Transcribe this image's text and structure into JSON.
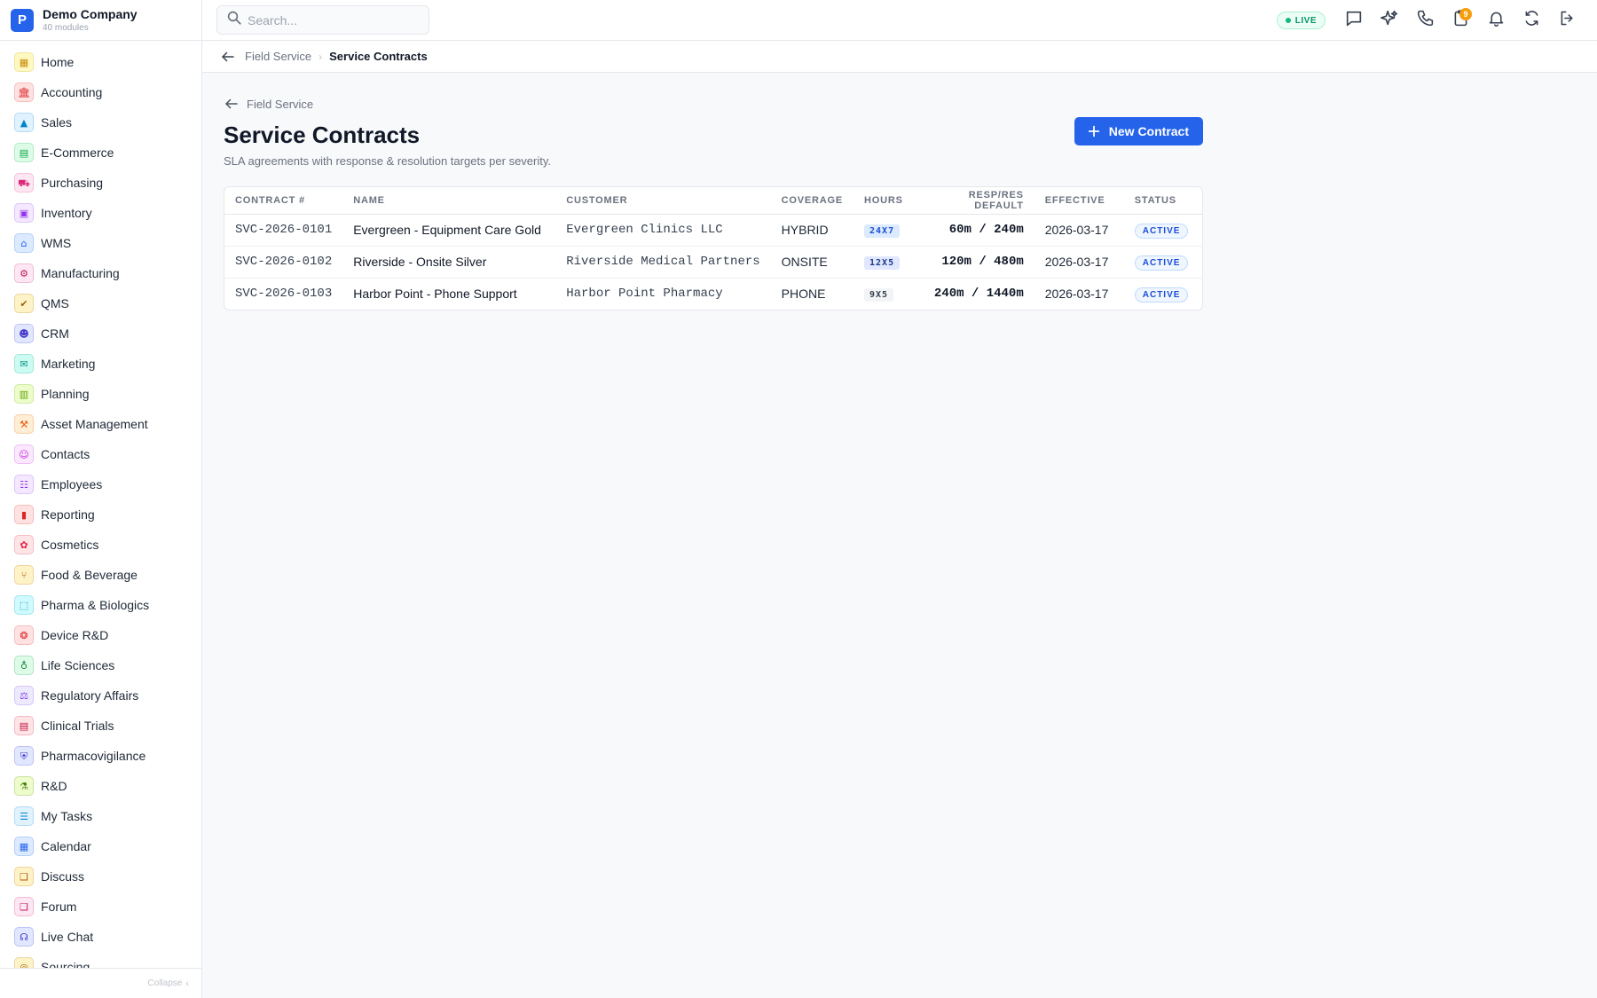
{
  "brand": {
    "logo_letter": "P",
    "name": "Demo Company",
    "subtitle": "40 modules"
  },
  "sidebar": {
    "items": [
      {
        "label": "Home",
        "icon": "grid-icon",
        "glyph": "▦",
        "color": "#ca8a04",
        "bg": "#fef9c3"
      },
      {
        "label": "Accounting",
        "icon": "bank-icon",
        "glyph": "🏛",
        "color": "#dc2626",
        "bg": "#fee2e2"
      },
      {
        "label": "Sales",
        "icon": "flask-icon",
        "glyph": "▲",
        "color": "#0284c7",
        "bg": "#e0f2fe"
      },
      {
        "label": "E-Commerce",
        "icon": "store-icon",
        "glyph": "▤",
        "color": "#16a34a",
        "bg": "#dcfce7"
      },
      {
        "label": "Purchasing",
        "icon": "cart-icon",
        "glyph": "⛟",
        "color": "#db2777",
        "bg": "#fce7f3"
      },
      {
        "label": "Inventory",
        "icon": "box-icon",
        "glyph": "▣",
        "color": "#9333ea",
        "bg": "#f3e8ff"
      },
      {
        "label": "WMS",
        "icon": "warehouse-icon",
        "glyph": "⌂",
        "color": "#2563eb",
        "bg": "#dbeafe"
      },
      {
        "label": "Manufacturing",
        "icon": "factory-icon",
        "glyph": "⚙",
        "color": "#be185d",
        "bg": "#fce7f3"
      },
      {
        "label": "QMS",
        "icon": "check-badge-icon",
        "glyph": "✔",
        "color": "#a16207",
        "bg": "#fef3c7"
      },
      {
        "label": "CRM",
        "icon": "users-icon",
        "glyph": "☻",
        "color": "#4338ca",
        "bg": "#e0e7ff"
      },
      {
        "label": "Marketing",
        "icon": "megaphone-icon",
        "glyph": "✉",
        "color": "#0d9488",
        "bg": "#ccfbf1"
      },
      {
        "label": "Planning",
        "icon": "clipboard-icon",
        "glyph": "▥",
        "color": "#65a30d",
        "bg": "#ecfccb"
      },
      {
        "label": "Asset Management",
        "icon": "tools-icon",
        "glyph": "⚒",
        "color": "#ea580c",
        "bg": "#ffedd5"
      },
      {
        "label": "Contacts",
        "icon": "contact-card-icon",
        "glyph": "☺",
        "color": "#c026d3",
        "bg": "#fae8ff"
      },
      {
        "label": "Employees",
        "icon": "id-badge-icon",
        "glyph": "☷",
        "color": "#9333ea",
        "bg": "#f3e8ff"
      },
      {
        "label": "Reporting",
        "icon": "bar-chart-icon",
        "glyph": "▮",
        "color": "#dc2626",
        "bg": "#fee2e2"
      },
      {
        "label": "Cosmetics",
        "icon": "flower-icon",
        "glyph": "✿",
        "color": "#e11d48",
        "bg": "#ffe4e6"
      },
      {
        "label": "Food & Beverage",
        "icon": "utensils-icon",
        "glyph": "⑂",
        "color": "#b45309",
        "bg": "#fef3c7"
      },
      {
        "label": "Pharma & Biologics",
        "icon": "pill-bottle-icon",
        "glyph": "⬚",
        "color": "#0891b2",
        "bg": "#cffafe"
      },
      {
        "label": "Device R&D",
        "icon": "chip-icon",
        "glyph": "❂",
        "color": "#dc2626",
        "bg": "#fee2e2"
      },
      {
        "label": "Life Sciences",
        "icon": "microscope-icon",
        "glyph": "♁",
        "color": "#15803d",
        "bg": "#dcfce7"
      },
      {
        "label": "Regulatory Affairs",
        "icon": "gavel-icon",
        "glyph": "⚖",
        "color": "#7c3aed",
        "bg": "#ede9fe"
      },
      {
        "label": "Clinical Trials",
        "icon": "clipboard-list-icon",
        "glyph": "▤",
        "color": "#be123c",
        "bg": "#ffe4e6"
      },
      {
        "label": "Pharmacovigilance",
        "icon": "shield-icon",
        "glyph": "⛨",
        "color": "#4338ca",
        "bg": "#e0e7ff"
      },
      {
        "label": "R&D",
        "icon": "beaker-icon",
        "glyph": "⚗",
        "color": "#4d7c0f",
        "bg": "#ecfccb"
      },
      {
        "label": "My Tasks",
        "icon": "checklist-icon",
        "glyph": "☰",
        "color": "#0284c7",
        "bg": "#e0f2fe"
      },
      {
        "label": "Calendar",
        "icon": "calendar-icon",
        "glyph": "▦",
        "color": "#2563eb",
        "bg": "#dbeafe"
      },
      {
        "label": "Discuss",
        "icon": "chat-bubbles-icon",
        "glyph": "❑",
        "color": "#b45309",
        "bg": "#fef3c7"
      },
      {
        "label": "Forum",
        "icon": "forum-icon",
        "glyph": "❑",
        "color": "#be185d",
        "bg": "#fce7f3"
      },
      {
        "label": "Live Chat",
        "icon": "headset-icon",
        "glyph": "☊",
        "color": "#4338ca",
        "bg": "#e0e7ff"
      },
      {
        "label": "Sourcing",
        "icon": "sourcing-icon",
        "glyph": "◎",
        "color": "#a16207",
        "bg": "#fef3c7"
      }
    ],
    "collapse_label": "Collapse"
  },
  "topbar": {
    "search_placeholder": "Search...",
    "live_label": "LIVE",
    "notification_count": "9"
  },
  "breadcrumb": {
    "parent": "Field Service",
    "current": "Service Contracts"
  },
  "page": {
    "back_label": "Field Service",
    "title": "Service Contracts",
    "subtitle": "SLA agreements with response & resolution targets per severity.",
    "new_button": "New Contract"
  },
  "table": {
    "headers": {
      "contract": "CONTRACT #",
      "name": "NAME",
      "customer": "CUSTOMER",
      "coverage": "COVERAGE",
      "hours": "HOURS",
      "resp": "RESP/RES DEFAULT",
      "effective": "EFFECTIVE",
      "status": "STATUS"
    },
    "rows": [
      {
        "contract": "SVC-2026-0101",
        "name": "Evergreen - Equipment Care Gold",
        "customer": "Evergreen Clinics LLC",
        "coverage": "HYBRID",
        "hours": "24X7",
        "hours_color": "#1d4ed8",
        "hours_bg": "#dbeafe",
        "resp": "60m / 240m",
        "effective": "2026-03-17",
        "status": "ACTIVE"
      },
      {
        "contract": "SVC-2026-0102",
        "name": "Riverside - Onsite Silver",
        "customer": "Riverside Medical Partners",
        "coverage": "ONSITE",
        "hours": "12X5",
        "hours_color": "#1e3a8a",
        "hours_bg": "#e0e7ff",
        "resp": "120m / 480m",
        "effective": "2026-03-17",
        "status": "ACTIVE"
      },
      {
        "contract": "SVC-2026-0103",
        "name": "Harbor Point - Phone Support",
        "customer": "Harbor Point Pharmacy",
        "coverage": "PHONE",
        "hours": "9X5",
        "hours_color": "#374151",
        "hours_bg": "#f3f4f6",
        "resp": "240m / 1440m",
        "effective": "2026-03-17",
        "status": "ACTIVE"
      }
    ]
  }
}
